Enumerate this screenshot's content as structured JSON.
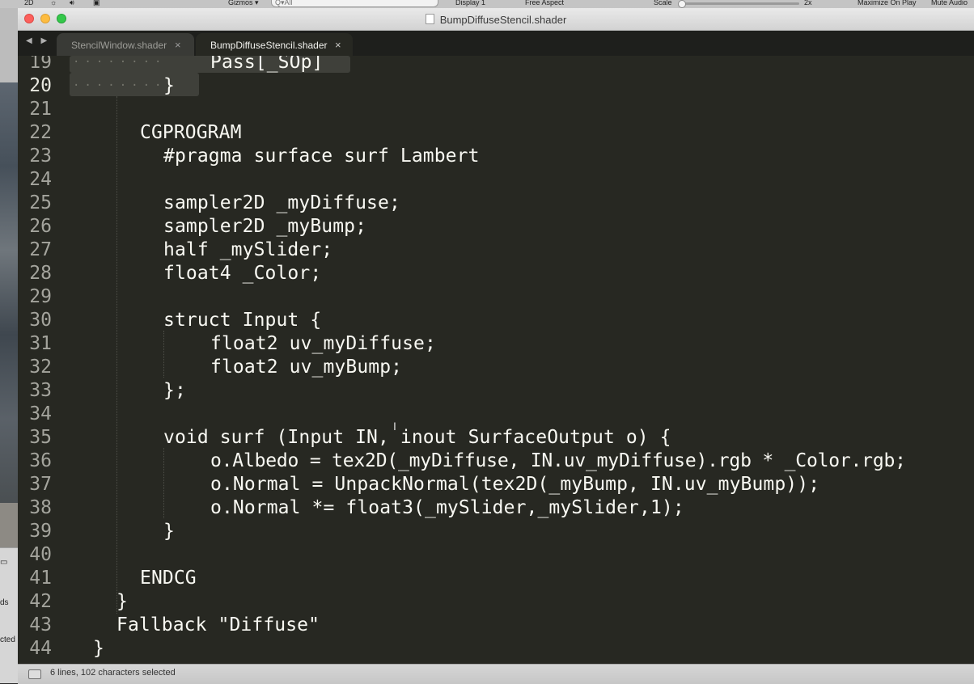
{
  "unity_toolbar": {
    "mode_2d": "2D",
    "gizmos": "Gizmos ▾",
    "search_placeholder": "Q▾All",
    "display": "Display 1",
    "aspect": "Free Aspect",
    "scale_label": "Scale",
    "scale_value": "2x",
    "maximize": "Maximize On Play",
    "mute": "Mute Audio"
  },
  "window": {
    "title": "BumpDiffuseStencil.shader"
  },
  "nav_arrows": "◀ ▶",
  "tabs": [
    {
      "label": "StencilWindow.shader",
      "close": "×",
      "active": false
    },
    {
      "label": "BumpDiffuseStencil.shader",
      "close": "×",
      "active": true
    }
  ],
  "code": {
    "lines": [
      {
        "n": "19",
        "text": "Pass[_SOp]"
      },
      {
        "n": "20",
        "text": "}"
      },
      {
        "n": "21",
        "text": ""
      },
      {
        "n": "22",
        "text": "CGPROGRAM"
      },
      {
        "n": "23",
        "text": "#pragma surface surf Lambert"
      },
      {
        "n": "24",
        "text": ""
      },
      {
        "n": "25",
        "text": "sampler2D _myDiffuse;"
      },
      {
        "n": "26",
        "text": "sampler2D _myBump;"
      },
      {
        "n": "27",
        "text": "half _mySlider;"
      },
      {
        "n": "28",
        "text": "float4 _Color;"
      },
      {
        "n": "29",
        "text": ""
      },
      {
        "n": "30",
        "text": "struct Input {"
      },
      {
        "n": "31",
        "text": "float2 uv_myDiffuse;"
      },
      {
        "n": "32",
        "text": "float2 uv_myBump;"
      },
      {
        "n": "33",
        "text": "};"
      },
      {
        "n": "34",
        "text": ""
      },
      {
        "n": "35",
        "text": "void surf (Input IN, inout SurfaceOutput o) {"
      },
      {
        "n": "36",
        "text": "o.Albedo = tex2D(_myDiffuse, IN.uv_myDiffuse).rgb * _Color.rgb;"
      },
      {
        "n": "37",
        "text": "o.Normal = UnpackNormal(tex2D(_myBump, IN.uv_myBump));"
      },
      {
        "n": "38",
        "text": "o.Normal *= float3(_mySlider,_mySlider,1);"
      },
      {
        "n": "39",
        "text": "}"
      },
      {
        "n": "40",
        "text": ""
      },
      {
        "n": "41",
        "text": "ENDCG"
      },
      {
        "n": "42",
        "text": "}"
      },
      {
        "n": "43",
        "text": "Fallback \"Diffuse\""
      },
      {
        "n": "44",
        "text": "}"
      }
    ]
  },
  "status": {
    "text": "6 lines, 102 characters selected"
  },
  "side_panel": {
    "labels": [
      "ds",
      "cted"
    ]
  },
  "colors": {
    "editor_bg": "#272822",
    "text": "#f8f8f2",
    "selection": "#3f403a"
  }
}
